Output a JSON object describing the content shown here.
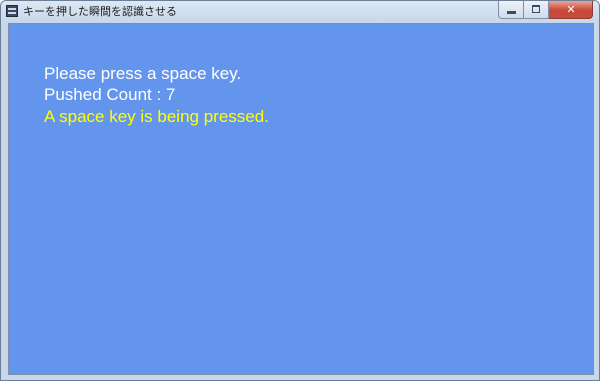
{
  "window": {
    "title": "キーを押した瞬間を認識させる",
    "icon": "app-window-icon",
    "controls": {
      "minimize_icon": "minimize-icon",
      "maximize_icon": "maximize-icon",
      "close_label": "✕"
    }
  },
  "content": {
    "background_color": "#6495ed",
    "lines": [
      {
        "text": "Please press a space key.",
        "color": "#ffffff"
      },
      {
        "text": "Pushed Count : 7",
        "color": "#ffffff"
      },
      {
        "text": "A space key is being pressed.",
        "color": "#ffff00"
      }
    ]
  }
}
